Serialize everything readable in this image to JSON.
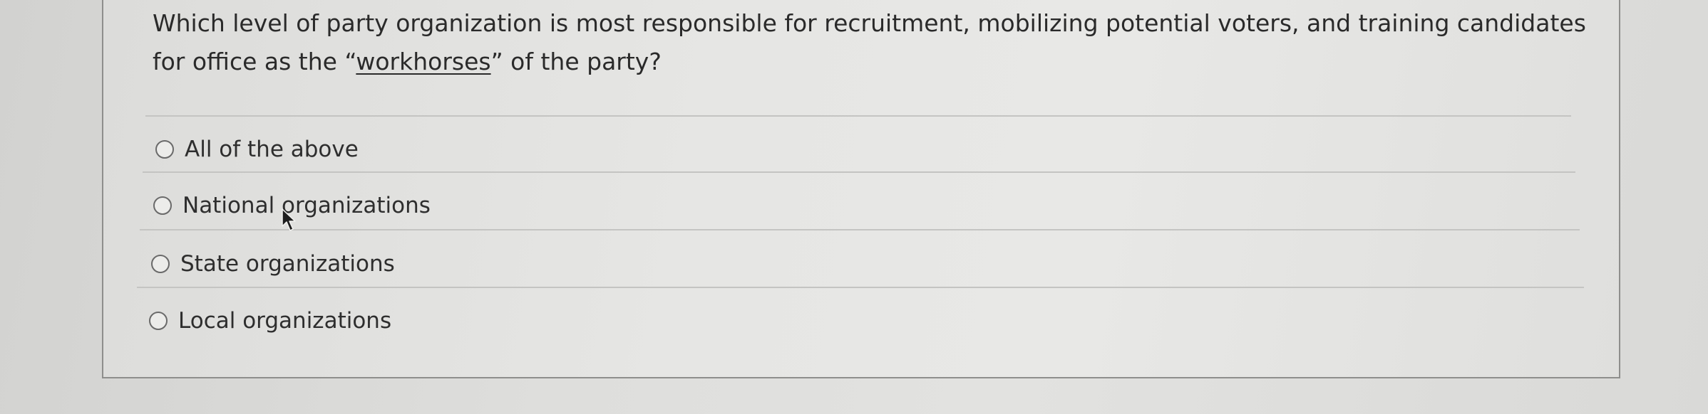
{
  "question": {
    "text_before": "Which level of party organization is most responsible for recruitment, mobilizing potential voters, and training candidates for office as the “",
    "emphasis": "workhorses",
    "text_after": "” of the party?"
  },
  "options": [
    {
      "label": "All of the above",
      "selected": false
    },
    {
      "label": "National organizations",
      "selected": false
    },
    {
      "label": "State organizations",
      "selected": false
    },
    {
      "label": "Local organizations",
      "selected": false
    }
  ],
  "icons": {
    "cursor": "mouse-pointer-icon"
  }
}
